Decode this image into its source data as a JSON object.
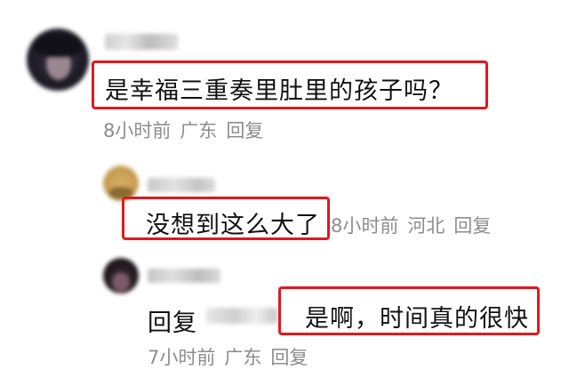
{
  "comments": [
    {
      "content": "是幸福三重奏里肚里的孩子吗？",
      "time": "8小时前",
      "location": "广东",
      "reply_label": "回复"
    },
    {
      "content": "没想到这么大了",
      "time": "8小时前",
      "location": "河北",
      "reply_label": "回复"
    },
    {
      "reply_prefix": "回复",
      "content": "是啊，时间真的很快",
      "time": "7小时前",
      "location": "广东",
      "reply_label": "回复"
    }
  ],
  "colors": {
    "highlight": "#e0191f",
    "meta_text": "#8d8d8d"
  }
}
